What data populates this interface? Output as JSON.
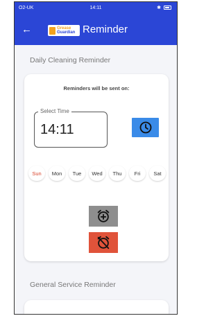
{
  "status_bar": {
    "carrier": "O2-UK",
    "time": "14:11"
  },
  "app_bar": {
    "back_glyph": "←",
    "logo_line1": "Grease",
    "logo_line2": "Guardian",
    "title": "Reminder"
  },
  "daily_reminder": {
    "section_title": "Daily Cleaning Reminder",
    "sent_on_label": "Reminders will be sent on:",
    "time_field": {
      "label": "Select Time",
      "value": "14:11"
    },
    "days": [
      {
        "label": "Sun",
        "selected": true
      },
      {
        "label": "Mon",
        "selected": false
      },
      {
        "label": "Tue",
        "selected": false
      },
      {
        "label": "Wed",
        "selected": false
      },
      {
        "label": "Thu",
        "selected": false
      },
      {
        "label": "Fri",
        "selected": false
      },
      {
        "label": "Sat",
        "selected": false
      }
    ],
    "icons": {
      "clock": "clock-icon",
      "add": "add-alarm-icon",
      "delete": "alarm-off-icon"
    }
  },
  "general_reminder": {
    "section_title": "General Service Reminder"
  },
  "colors": {
    "primary": "#2b46d6",
    "clock_button": "#3a8be8",
    "add_button": "#8e8e8e",
    "delete_button": "#e0533a",
    "selected_day": "#d9432a"
  }
}
